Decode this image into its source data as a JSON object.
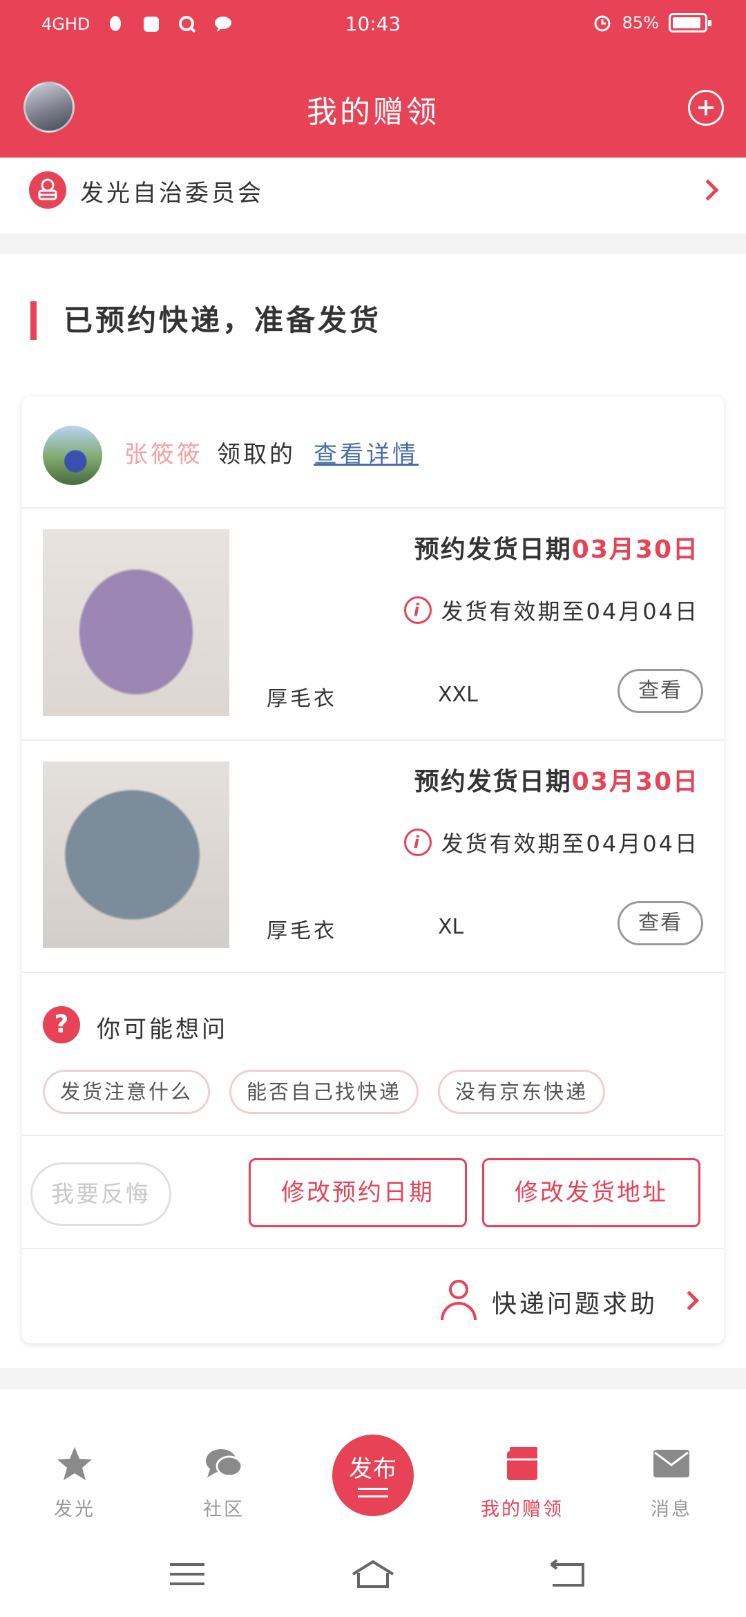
{
  "status_bar": {
    "network": "4GHD",
    "time": "10:43",
    "battery": "85%"
  },
  "app_bar": {
    "title": "我的赠领"
  },
  "org": {
    "name": "发光自治委员会"
  },
  "section": {
    "title": "已预约快递，准备发货"
  },
  "card": {
    "receiver_name": "张筱筱",
    "receiver_verb": "领取的",
    "view_detail_label": "查看详情",
    "items": [
      {
        "ship_label": "预约发货日期",
        "ship_date": "03月30日",
        "valid_until": "发货有效期至04月04日",
        "name": "厚毛衣",
        "size": "XXL",
        "view_label": "查看"
      },
      {
        "ship_label": "预约发货日期",
        "ship_date": "03月30日",
        "valid_until": "发货有效期至04月04日",
        "name": "厚毛衣",
        "size": "XL",
        "view_label": "查看"
      }
    ],
    "faq": {
      "title": "你可能想问",
      "chips": [
        "发货注意什么",
        "能否自己找快递",
        "没有京东快递"
      ]
    },
    "actions": {
      "regret_label": "我要反悔",
      "change_date_label": "修改预约日期",
      "change_address_label": "修改发货地址"
    },
    "help_label": "快递问题求助"
  },
  "tabbar": {
    "tabs": [
      {
        "label": "发光",
        "icon": "star-icon"
      },
      {
        "label": "社区",
        "icon": "chat-bubbles-icon"
      },
      {
        "label": "发布",
        "icon": "publish-icon"
      },
      {
        "label": "我的赠领",
        "icon": "gift-box-icon",
        "active": true
      },
      {
        "label": "消息",
        "icon": "envelope-icon"
      }
    ]
  },
  "colors": {
    "brand": "#e74255",
    "muted": "#999999",
    "link": "#4a6fa5"
  }
}
